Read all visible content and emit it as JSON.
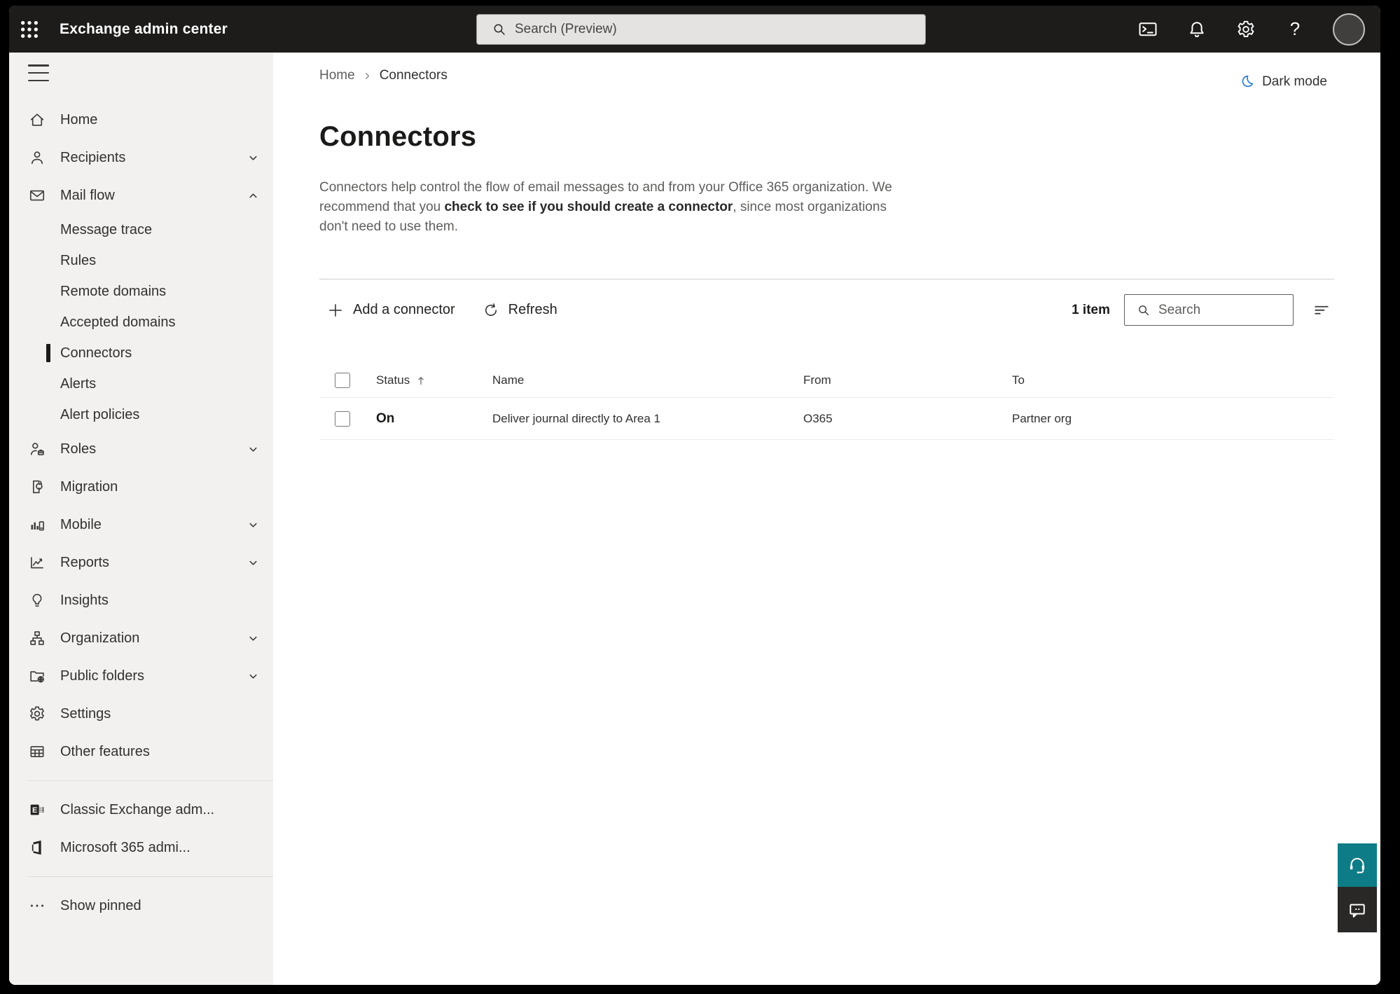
{
  "topbar": {
    "app_title": "Exchange admin center",
    "search_placeholder": "Search (Preview)",
    "icons": [
      "app-launcher-icon",
      "terminal-icon",
      "notifications-bell-icon",
      "settings-gear-icon",
      "help-icon",
      "account-avatar"
    ],
    "help_glyph": "?"
  },
  "sidebar": {
    "items": [
      {
        "label": "Home",
        "icon": "home-icon",
        "level": "top",
        "chevron": null,
        "selected": false
      },
      {
        "label": "Recipients",
        "icon": "person-icon",
        "level": "top",
        "chevron": "down",
        "selected": false
      },
      {
        "label": "Mail flow",
        "icon": "mail-icon",
        "level": "top",
        "chevron": "up",
        "selected": false
      },
      {
        "label": "Message trace",
        "icon": null,
        "level": "sub",
        "chevron": null,
        "selected": false
      },
      {
        "label": "Rules",
        "icon": null,
        "level": "sub",
        "chevron": null,
        "selected": false
      },
      {
        "label": "Remote domains",
        "icon": null,
        "level": "sub",
        "chevron": null,
        "selected": false
      },
      {
        "label": "Accepted domains",
        "icon": null,
        "level": "sub",
        "chevron": null,
        "selected": false
      },
      {
        "label": "Connectors",
        "icon": null,
        "level": "sub",
        "chevron": null,
        "selected": true
      },
      {
        "label": "Alerts",
        "icon": null,
        "level": "sub",
        "chevron": null,
        "selected": false
      },
      {
        "label": "Alert policies",
        "icon": null,
        "level": "sub",
        "chevron": null,
        "selected": false
      },
      {
        "label": "Roles",
        "icon": "person-badge-icon",
        "level": "top",
        "chevron": "down",
        "selected": false
      },
      {
        "label": "Migration",
        "icon": "migration-icon",
        "level": "top",
        "chevron": null,
        "selected": false
      },
      {
        "label": "Mobile",
        "icon": "mobile-chart-icon",
        "level": "top",
        "chevron": "down",
        "selected": false
      },
      {
        "label": "Reports",
        "icon": "reports-chart-icon",
        "level": "top",
        "chevron": "down",
        "selected": false
      },
      {
        "label": "Insights",
        "icon": "lightbulb-icon",
        "level": "top",
        "chevron": null,
        "selected": false
      },
      {
        "label": "Organization",
        "icon": "org-chart-icon",
        "level": "top",
        "chevron": "down",
        "selected": false
      },
      {
        "label": "Public folders",
        "icon": "folder-globe-icon",
        "level": "top",
        "chevron": "down",
        "selected": false
      },
      {
        "label": "Settings",
        "icon": "gear-icon",
        "level": "top",
        "chevron": null,
        "selected": false
      },
      {
        "label": "Other features",
        "icon": "table-grid-icon",
        "level": "top",
        "chevron": null,
        "selected": false
      },
      {
        "label": "Classic Exchange adm...",
        "icon": "exchange-logo-icon",
        "level": "top",
        "chevron": null,
        "selected": false
      },
      {
        "label": "Microsoft 365 admi...",
        "icon": "microsoft365-logo-icon",
        "level": "top",
        "chevron": null,
        "selected": false
      },
      {
        "label": "Show pinned",
        "icon": "ellipsis-icon",
        "level": "top",
        "chevron": null,
        "selected": false
      }
    ]
  },
  "breadcrumb": {
    "home": "Home",
    "current": "Connectors"
  },
  "darkmode": {
    "label": "Dark mode",
    "icon": "moon-icon",
    "icon_color": "#2b7cd3"
  },
  "page": {
    "title": "Connectors",
    "desc_before": "Connectors help control the flow of email messages to and from your Office 365 organization. We recommend that you ",
    "desc_link": "check to see if you should create a connector",
    "desc_after": ", since most organizations don't need to use them."
  },
  "toolbar": {
    "add_label": "Add a connector",
    "refresh_label": "Refresh",
    "count": "1 item",
    "search_placeholder": "Search",
    "icons": [
      "plus-icon",
      "refresh-icon",
      "search-icon",
      "filter-lines-icon"
    ]
  },
  "table": {
    "columns": [
      "Status",
      "Name",
      "From",
      "To"
    ],
    "sorted_column": "Status",
    "sort_direction": "ascending",
    "rows": [
      {
        "status": "On",
        "name": "Deliver journal directly to Area 1",
        "from": "O365",
        "to": "Partner org"
      }
    ]
  },
  "float_buttons": {
    "support_icon": "headset-icon",
    "feedback_icon": "feedback-bubble-icon"
  },
  "colors": {
    "topbar_bg": "#1d1c1b",
    "sidebar_bg": "#f2f1ef",
    "accent_moon_blue": "#2b7cd3",
    "support_teal": "#0e7c86",
    "feedback_dark": "#292827"
  }
}
